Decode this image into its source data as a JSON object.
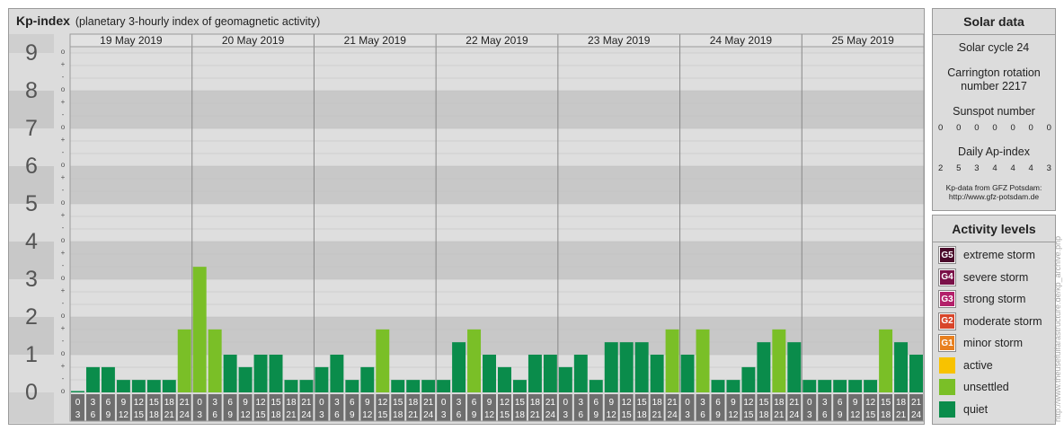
{
  "header": {
    "title": "Kp-index",
    "subtitle": "(planetary 3-hourly index of geomagnetic activity)"
  },
  "chart_data": {
    "type": "bar",
    "days": [
      "19 May 2019",
      "20 May 2019",
      "21 May 2019",
      "22 May 2019",
      "23 May 2019",
      "24 May 2019",
      "25 May 2019"
    ],
    "interval_labels": [
      [
        "0",
        "3"
      ],
      [
        "3",
        "6"
      ],
      [
        "6",
        "9"
      ],
      [
        "9",
        "12"
      ],
      [
        "12",
        "15"
      ],
      [
        "15",
        "18"
      ],
      [
        "18",
        "21"
      ],
      [
        "21",
        "24"
      ]
    ],
    "y_ticks": [
      "0",
      "1",
      "2",
      "3",
      "4",
      "5",
      "6",
      "7",
      "8",
      "9"
    ],
    "y_minor_ticks": [
      "o",
      "+",
      "-",
      "o"
    ],
    "ylim": [
      0,
      9
    ],
    "values": [
      0.0,
      0.67,
      0.67,
      0.33,
      0.33,
      0.33,
      0.33,
      1.67,
      3.33,
      1.67,
      1.0,
      0.67,
      1.0,
      1.0,
      0.33,
      0.33,
      0.67,
      1.0,
      0.33,
      0.67,
      1.67,
      0.33,
      0.33,
      0.33,
      0.33,
      1.33,
      1.67,
      1.0,
      0.67,
      0.33,
      1.0,
      1.0,
      0.67,
      1.0,
      0.33,
      1.33,
      1.33,
      1.33,
      1.0,
      1.67,
      1.0,
      1.67,
      0.33,
      0.33,
      0.67,
      1.33,
      1.67,
      1.33,
      0.33,
      0.33,
      0.33,
      0.33,
      0.33,
      1.67,
      1.33,
      1.0
    ],
    "level_colors": {
      "quiet": "#0a8c4b",
      "unsettled": "#7abf27",
      "active": "#f8c200"
    }
  },
  "solar": {
    "title": "Solar data",
    "cycle": "Solar cycle 24",
    "carrington_line1": "Carrington rotation",
    "carrington_line2": "number 2217",
    "sunspot_label": "Sunspot number",
    "sunspot_values": [
      "0",
      "0",
      "0",
      "0",
      "0",
      "0",
      "0"
    ],
    "ap_label": "Daily Ap-index",
    "ap_values": [
      "2",
      "5",
      "3",
      "4",
      "4",
      "4",
      "3"
    ],
    "source_line1": "Kp-data from GFZ Potsdam:",
    "source_line2": "http://www.gfz-potsdam.de"
  },
  "activity": {
    "title": "Activity levels",
    "levels": [
      {
        "code": "G5",
        "label": "extreme storm",
        "color": "#4a0a2a"
      },
      {
        "code": "G4",
        "label": "severe storm",
        "color": "#7a1048"
      },
      {
        "code": "G3",
        "label": "strong storm",
        "color": "#b3206a"
      },
      {
        "code": "G2",
        "label": "moderate storm",
        "color": "#d8452a"
      },
      {
        "code": "G1",
        "label": "minor storm",
        "color": "#e8801f"
      },
      {
        "code": "",
        "label": "active",
        "color": "#f8c200"
      },
      {
        "code": "",
        "label": "unsettled",
        "color": "#7abf27"
      },
      {
        "code": "",
        "label": "quiet",
        "color": "#0a8c4b"
      }
    ]
  },
  "watermark": "http://www.theusefulfarastructure.de/kp_archive.php"
}
